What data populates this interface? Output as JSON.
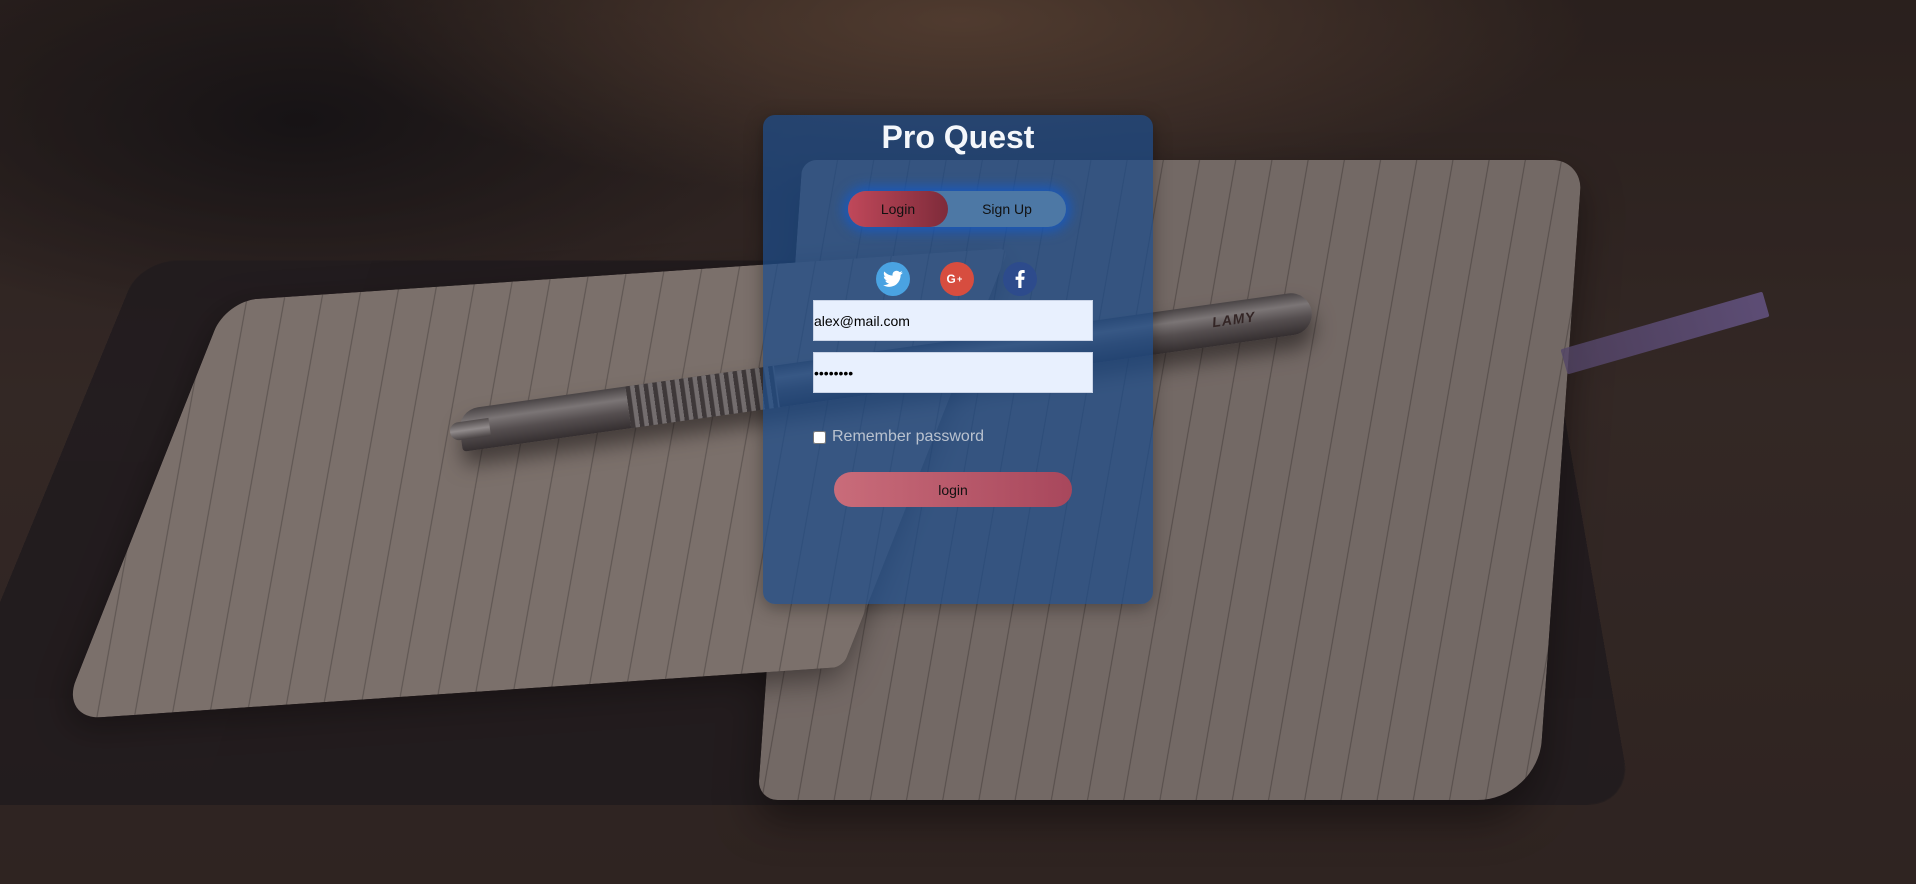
{
  "app": {
    "title": "Pro Quest"
  },
  "toggle": {
    "login_label": "Login",
    "signup_label": "Sign Up",
    "active": "Login"
  },
  "social": {
    "twitter_icon": "twitter-icon",
    "google_icon": "google-plus-icon",
    "facebook_icon": "facebook-icon"
  },
  "form": {
    "email_value": "alex@mail.com",
    "password_value": "••••••••",
    "remember_label": "Remember password",
    "remember_checked": false,
    "submit_label": "login"
  },
  "background": {
    "pen_brand": "LAMY"
  },
  "colors": {
    "card": "#1e4e8c",
    "accent": "#c0485a",
    "twitter": "#4aa3e2",
    "google": "#d74d3f",
    "facebook": "#2d4b8c"
  }
}
